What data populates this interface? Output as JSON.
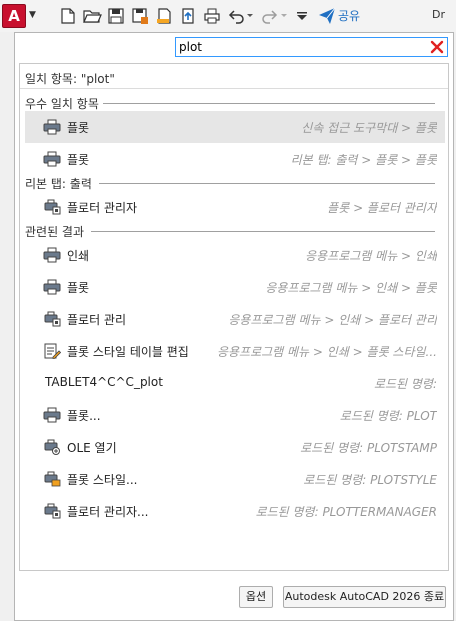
{
  "app": {
    "logo_letter": "A",
    "title_cut": "Dr"
  },
  "quick_access": {
    "icons": [
      "new-file-icon",
      "open-folder-icon",
      "save-icon",
      "save-as-icon",
      "open-web-icon",
      "share-upload-icon",
      "plot-printer-icon",
      "undo-icon",
      "redo-icon",
      "customize-dropdown-icon"
    ],
    "share_label": "공유"
  },
  "search": {
    "value": "plot"
  },
  "results": {
    "match_header": "일치 항목: \"plot\"",
    "sections": [
      {
        "title": "우수 일치 항목"
      },
      {
        "title": "리본 탭: 출력"
      },
      {
        "title": "관련된 결과"
      }
    ],
    "best": [
      {
        "label": "플롯",
        "path": "신속 접근 도구막대 > 플롯",
        "icon": "plot-printer-icon",
        "highlighted": true
      },
      {
        "label": "플롯",
        "path": "리본 탭: 출력 > 플롯 > 플롯",
        "icon": "plot-printer-icon"
      }
    ],
    "ribbon": [
      {
        "label": "플로터 관리자",
        "path": "플롯 > 플로터 관리자",
        "icon": "plotter-manager-icon"
      }
    ],
    "related": [
      {
        "label": "인쇄",
        "path": "응용프로그램 메뉴 > 인쇄",
        "icon": "plot-printer-icon"
      },
      {
        "label": "플롯",
        "path": "응용프로그램 메뉴 > 인쇄 > 플롯",
        "icon": "plot-printer-icon"
      },
      {
        "label": "플로터 관리",
        "path": "응용프로그램 메뉴 > 인쇄 > 플로터 관리",
        "icon": "plotter-manager-icon"
      },
      {
        "label": "플롯 스타일 테이블 편집",
        "path": "응용프로그램 메뉴 > 인쇄 > 플롯 스타일...",
        "icon": "plot-style-edit-icon"
      },
      {
        "label": "TABLET4^C^C_plot",
        "path": "로드된 명령:",
        "icon": ""
      },
      {
        "label": "플롯...",
        "path": "로드된 명령: PLOT",
        "icon": "plot-printer-icon"
      },
      {
        "label": "OLE 열기",
        "path": "로드된 명령: PLOTSTAMP",
        "icon": "plot-stamp-icon"
      },
      {
        "label": "플롯 스타일...",
        "path": "로드된 명령: PLOTSTYLE",
        "icon": "plot-style-icon"
      },
      {
        "label": "플로터 관리자...",
        "path": "로드된 명령: PLOTTERMANAGER",
        "icon": "plotter-manager-icon"
      }
    ]
  },
  "buttons": {
    "options": "옵션",
    "exit": "Autodesk AutoCAD 2026 종료"
  },
  "colors": {
    "accent": "#3399ff",
    "brand_red": "#c8102e",
    "share_blue": "#1f6fc2",
    "clear_red": "#e02020",
    "highlight": "#e6e6e6"
  }
}
